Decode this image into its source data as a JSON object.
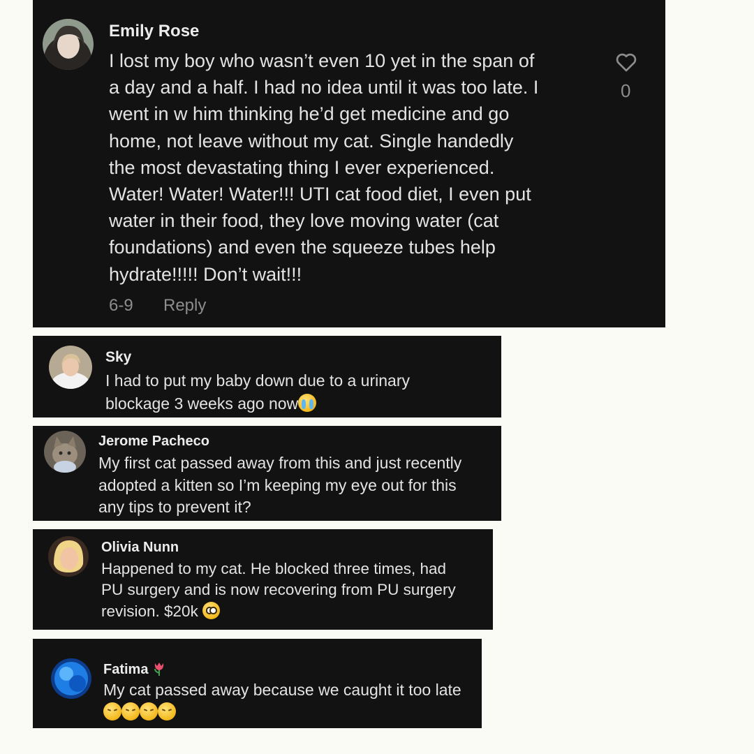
{
  "comments": [
    {
      "name": "Emily Rose",
      "lines": [
        "I lost my boy who wasn’t even 10 yet in the span of",
        "a day and a half. I had no idea until it was too late. I",
        "went in w him thinking he’d get medicine and go",
        "home, not leave without my cat. Single handedly",
        "the most devastating thing I ever experienced.",
        "Water! Water! Water!!! UTI cat food diet, I even put",
        "water in their food, they love moving water (cat",
        "foundations) and even the squeeze tubes help",
        "hydrate!!!!! Don’t wait!!!"
      ],
      "date": "6-9",
      "reply_label": "Reply",
      "like_count": "0",
      "like_icon": "heart-outline-icon"
    },
    {
      "name": "Sky",
      "lines": [
        "I had to put my baby down due to a urinary",
        "blockage 3 weeks ago now"
      ],
      "emoji": "loudly-crying-face-icon"
    },
    {
      "name": "Jerome Pacheco",
      "lines": [
        "My first cat passed away from this and just recently",
        "adopted a kitten so I’m keeping my eye out for this",
        "any tips to prevent it?"
      ]
    },
    {
      "name": "Olivia Nunn",
      "lines": [
        "Happened to my cat. He blocked three times, had",
        "PU surgery and is now recovering from PU surgery",
        "revision. $20k"
      ],
      "emoji": "pleading-face-icon"
    },
    {
      "name": "Fatima",
      "name_emoji": "tulip-icon",
      "lines": [
        "My cat passed away because we caught it too late"
      ],
      "emoji": "pensive-face-icon",
      "emoji_count": 4
    }
  ],
  "colors": {
    "page_background": "#fbfbf6",
    "card_background": "#121212",
    "text": "#e3e3e3",
    "meta": "#8d8d8d"
  }
}
